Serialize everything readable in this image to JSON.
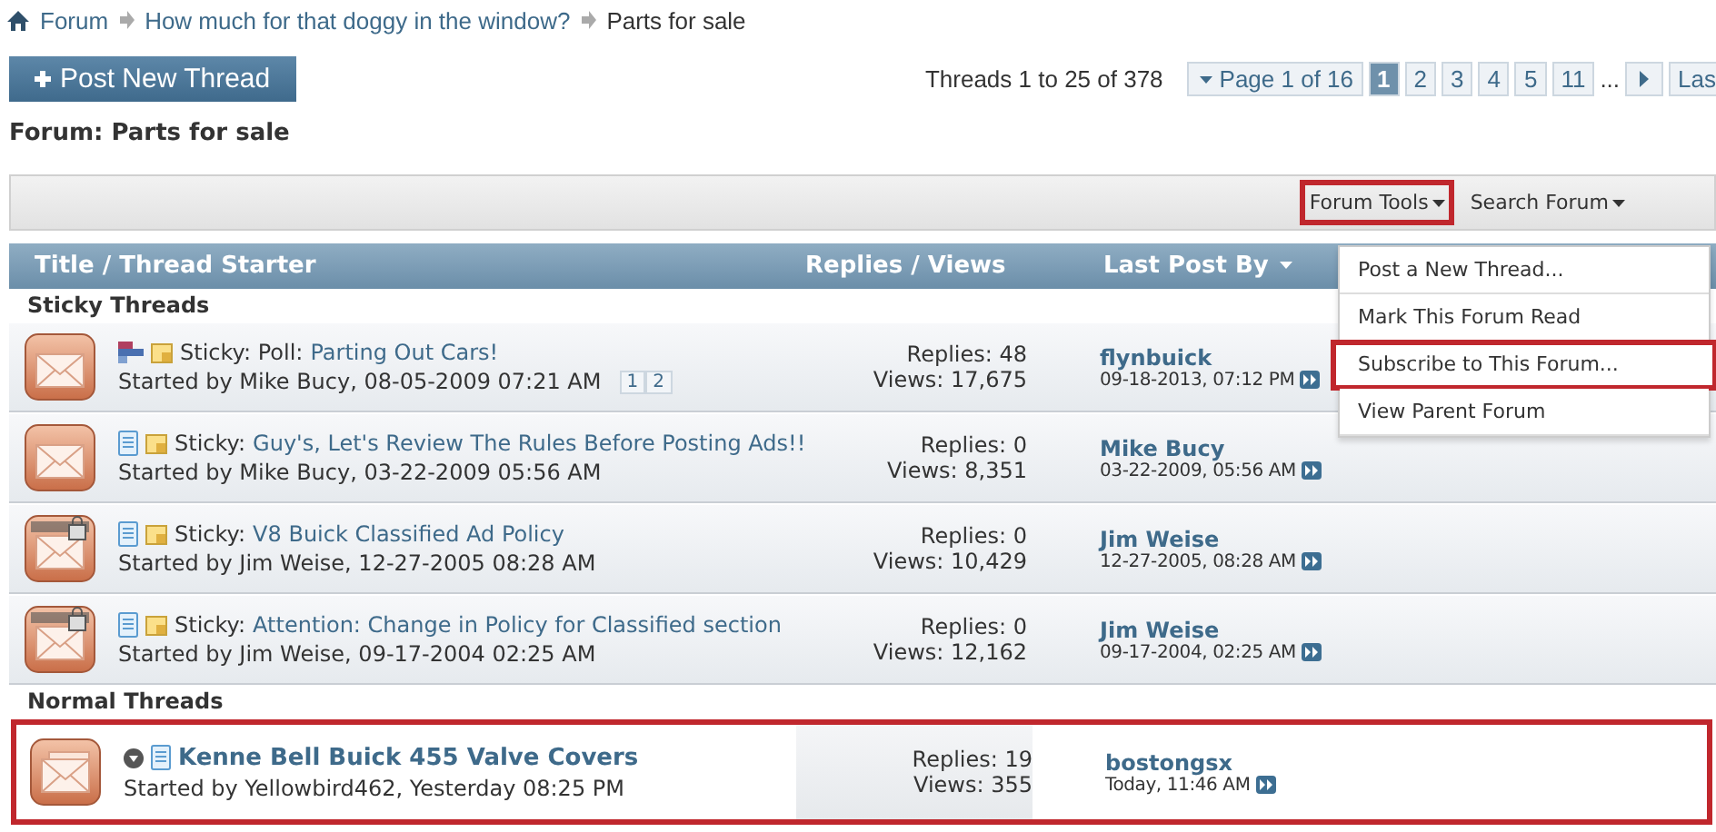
{
  "breadcrumb": [
    "Forum",
    "How much for that doggy in the window?",
    "Parts for sale"
  ],
  "post_button": "Post New Thread",
  "pagination": {
    "summary": "Threads 1 to 25 of 378",
    "page_label": "Page 1 of 16",
    "pages": [
      {
        "label": "1",
        "selected": true
      },
      {
        "label": "2",
        "selected": false
      },
      {
        "label": "3",
        "selected": false
      },
      {
        "label": "4",
        "selected": false
      },
      {
        "label": "5",
        "selected": false
      },
      {
        "label": "11",
        "selected": false
      }
    ],
    "ellipsis": "...",
    "last": "Las"
  },
  "forum_title": "Forum: Parts for sale",
  "toolbar": [
    {
      "label": "Forum Tools",
      "highlighted": true
    },
    {
      "label": "Search Forum",
      "highlighted": false
    }
  ],
  "menu": [
    {
      "label": "Post a New Thread...",
      "highlighted": false
    },
    {
      "label": "Mark This Forum Read",
      "highlighted": false
    },
    {
      "label": "Subscribe to This Forum...",
      "highlighted": true
    },
    {
      "label": "View Parent Forum",
      "highlighted": false
    }
  ],
  "columns": [
    "Title / Thread Starter",
    "Replies / Views",
    "Last Post By"
  ],
  "sections": [
    {
      "title": "Sticky Threads",
      "threads": [
        {
          "status_icon": {
            "kind": "normal"
          },
          "type_icon": {
            "kind": "poll"
          },
          "sticky": true,
          "unread": false,
          "highlighted": false,
          "prefix": "Sticky: Poll:",
          "title": "Parting Out Cars!",
          "starter": "Started by Mike Bucy, 08-05-2009 07:21 AM",
          "pages": [
            "1",
            "2"
          ],
          "replies": "Replies: 48",
          "views": "Views: 17,675",
          "last_by": "flynbuick",
          "last_date": "09-18-2013, 07:12 PM"
        },
        {
          "status_icon": {
            "kind": "normal"
          },
          "type_icon": {
            "kind": "doc"
          },
          "sticky": true,
          "unread": false,
          "highlighted": false,
          "prefix": "Sticky:",
          "title": "Guy's, Let's Review The Rules Before Posting Ads!!",
          "starter": "Started by Mike Bucy, 03-22-2009 05:56 AM",
          "replies": "Replies: 0",
          "views": "Views: 8,351",
          "last_by": "Mike Bucy",
          "last_date": "03-22-2009, 05:56 AM"
        },
        {
          "status_icon": {
            "kind": "locked"
          },
          "type_icon": {
            "kind": "doc"
          },
          "sticky": true,
          "unread": false,
          "highlighted": false,
          "prefix": "Sticky:",
          "title": "V8 Buick Classified Ad Policy",
          "starter": "Started by Jim Weise, 12-27-2005 08:28 AM",
          "replies": "Replies: 0",
          "views": "Views: 10,429",
          "last_by": "Jim Weise",
          "last_date": "12-27-2005, 08:28 AM"
        },
        {
          "status_icon": {
            "kind": "locked"
          },
          "type_icon": {
            "kind": "doc"
          },
          "sticky": true,
          "unread": false,
          "highlighted": false,
          "prefix": "Sticky:",
          "title": "Attention: Change in Policy for Classified section",
          "starter": "Started by Jim Weise, 09-17-2004 02:25 AM",
          "replies": "Replies: 0",
          "views": "Views: 12,162",
          "last_by": "Jim Weise",
          "last_date": "09-17-2004, 02:25 AM"
        }
      ]
    },
    {
      "title": "Normal Threads",
      "threads": [
        {
          "status_icon": {
            "kind": "multi"
          },
          "type_icon": {
            "kind": "doc"
          },
          "sticky": false,
          "unread": true,
          "highlighted": true,
          "title": "Kenne Bell Buick 455 Valve Covers",
          "starter": "Started by Yellowbird462, Yesterday 08:25 PM",
          "replies": "Replies: 19",
          "views": "Views: 355",
          "last_by": "bostongsx",
          "last_date": "Today, 11:46 AM"
        }
      ]
    }
  ]
}
